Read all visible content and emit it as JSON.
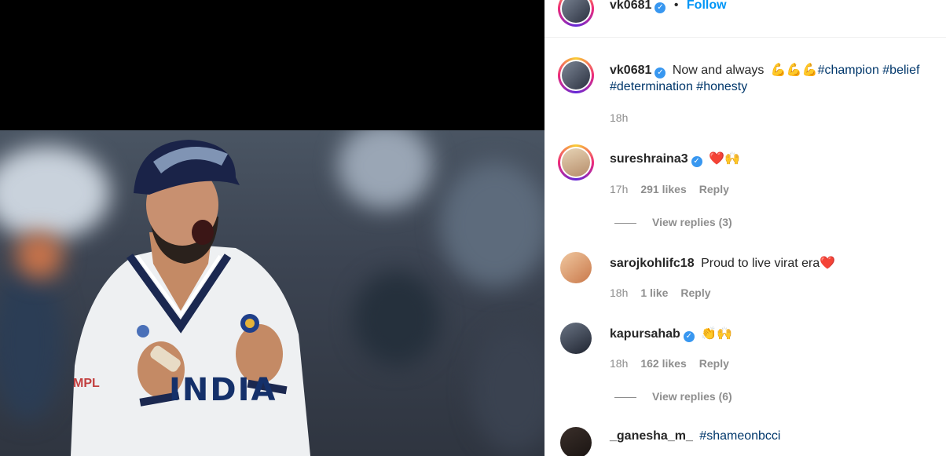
{
  "header": {
    "username": "vk0681",
    "separator": "•",
    "follow_label": "Follow"
  },
  "caption": {
    "username": "vk0681",
    "text": "Now and always",
    "emojis": "💪💪💪",
    "line1_tags": "#champion #belief",
    "line2_tags": "#determination #honesty",
    "time": "18h"
  },
  "comments": [
    {
      "username": "sureshraina3",
      "verified": true,
      "text": "",
      "emojis": "❤️🙌",
      "time": "17h",
      "likes": "291 likes",
      "reply_label": "Reply",
      "view_replies": "View replies (3)"
    },
    {
      "username": "sarojkohlifc18",
      "verified": false,
      "text": "Proud to live virat era",
      "emojis": "❤️",
      "time": "18h",
      "likes": "1 like",
      "reply_label": "Reply",
      "view_replies": ""
    },
    {
      "username": "kapursahab",
      "verified": true,
      "text": "",
      "emojis": "👏🙌",
      "time": "18h",
      "likes": "162 likes",
      "reply_label": "Reply",
      "view_replies": "View replies (6)"
    },
    {
      "username": "_ganesha_m_",
      "verified": false,
      "text": "#shameonbcci",
      "emojis": "",
      "time": "",
      "likes": "",
      "reply_label": "",
      "view_replies": ""
    }
  ],
  "photo": {
    "jersey_text": "INDIA",
    "sponsor_text": "MPL"
  },
  "colors": {
    "link": "#0095f6",
    "hashtag": "#00376b",
    "verified": "#3897f0",
    "muted": "#8e8e8e"
  }
}
